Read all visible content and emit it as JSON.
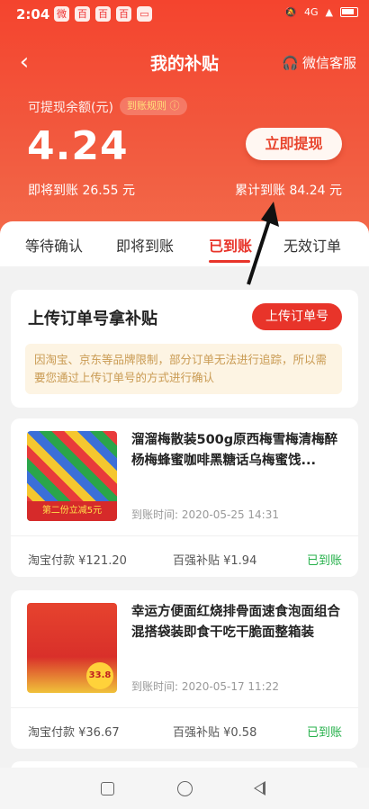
{
  "status_bar": {
    "time": "2:04",
    "network": "4G"
  },
  "header": {
    "title": "我的补贴",
    "service_label": "微信客服"
  },
  "balance": {
    "label": "可提现余额(元)",
    "rule_label": "到账规则",
    "amount": "4.24",
    "withdraw_label": "立即提现",
    "upcoming": "即将到账 26.55 元",
    "cumulative": "累计到账 84.24 元"
  },
  "tabs": [
    {
      "label": "等待确认"
    },
    {
      "label": "即将到账"
    },
    {
      "label": "已到账"
    },
    {
      "label": "无效订单"
    }
  ],
  "upload": {
    "title": "上传订单号拿补贴",
    "button_label": "上传订单号",
    "notice": "因淘宝、京东等品牌限制，部分订单无法进行追踪，所以需要您通过上传订单号的方式进行确认"
  },
  "orders": [
    {
      "name": "溜溜梅散装500g原西梅雪梅清梅醉杨梅蜂蜜咖啡黑糖话乌梅蜜饯...",
      "arrival_time": "到账时间: 2020-05-25 14:31",
      "payment": "淘宝付款 ¥121.20",
      "subsidy": "百强补贴 ¥1.94",
      "status": "已到账",
      "thumb_tag": "第二份立减5元"
    },
    {
      "name": "幸运方便面红烧排骨面速食泡面组合混搭袋装即食干吃干脆面整箱装",
      "arrival_time": "到账时间: 2020-05-17 11:22",
      "payment": "淘宝付款 ¥36.67",
      "subsidy": "百强补贴 ¥0.58",
      "status": "已到账",
      "thumb_price": "33.8"
    }
  ],
  "colors": {
    "accent": "#e8342a",
    "success": "#25b04a",
    "hero": "#f4442e"
  }
}
